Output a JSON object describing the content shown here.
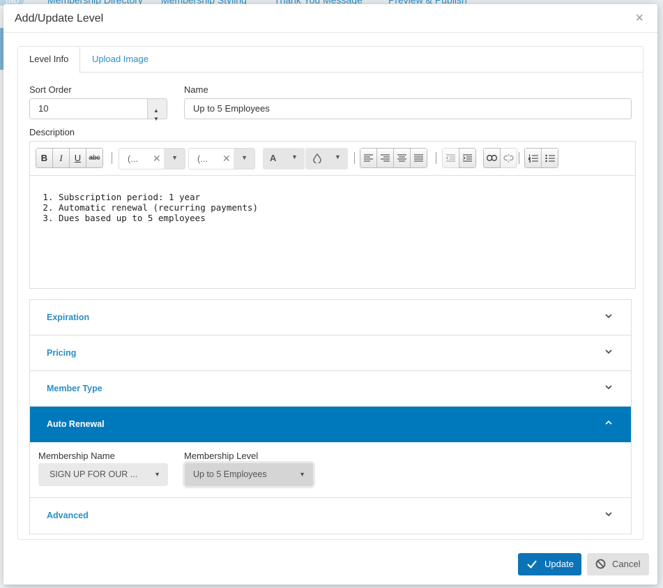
{
  "background": {
    "tabs": [
      "tab",
      "Membership Directory",
      "Membership Styling",
      "Thank You Message",
      "Preview & Publish"
    ]
  },
  "modal": {
    "title": "Add/Update Level",
    "close_symbol": "×"
  },
  "tabs": [
    {
      "label": "Level Info",
      "active": true
    },
    {
      "label": "Upload Image",
      "active": false
    }
  ],
  "form": {
    "sort_order": {
      "label": "Sort Order",
      "value": "10"
    },
    "name": {
      "label": "Name",
      "value": "Up to 5 Employees"
    },
    "description": {
      "label": "Description",
      "toolbar": {
        "bold": "B",
        "italic": "I",
        "underline": "U",
        "strike": "abc",
        "font_family": "(...",
        "font_size": "(...",
        "text_color": "A"
      },
      "items": [
        "Subscription period: 1 year",
        "Automatic renewal (recurring payments)",
        "Dues based up to 5 employees"
      ]
    }
  },
  "accordion": {
    "sections": [
      {
        "label": "Expiration",
        "open": false
      },
      {
        "label": "Pricing",
        "open": false
      },
      {
        "label": "Member Type",
        "open": false
      },
      {
        "label": "Auto Renewal",
        "open": true
      },
      {
        "label": "Advanced",
        "open": false
      }
    ],
    "auto_renewal": {
      "membership_name": {
        "label": "Membership Name",
        "value": "SIGN UP FOR OUR ..."
      },
      "membership_level": {
        "label": "Membership Level",
        "value": "Up to 5 Employees"
      }
    }
  },
  "footer": {
    "update_label": "Update",
    "cancel_label": "Cancel"
  },
  "colors": {
    "accent": "#0079bc",
    "link": "#2a8fc6",
    "update_button": "#0b73b7"
  }
}
